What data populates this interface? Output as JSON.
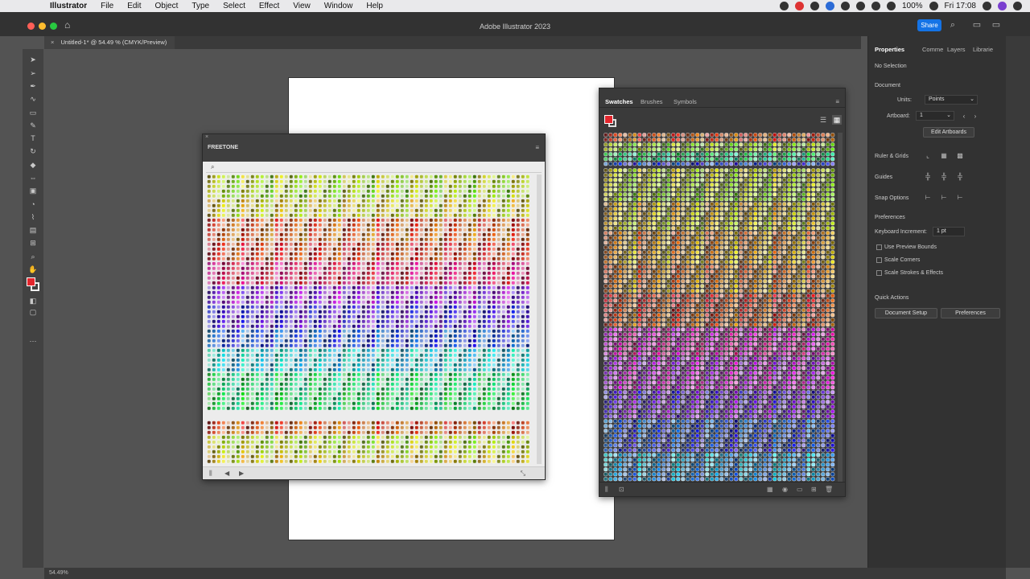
{
  "menubar": {
    "app": "Illustrator",
    "items": [
      "File",
      "Edit",
      "Object",
      "Type",
      "Select",
      "Effect",
      "View",
      "Window",
      "Help"
    ],
    "battery": "100%",
    "clock": "Fri 17:08"
  },
  "window": {
    "title": "Adobe Illustrator 2023",
    "share_label": "Share"
  },
  "document": {
    "tab_title": "Untitled-1* @ 54.49 % (CMYK/Preview)",
    "zoom": "54.49%"
  },
  "freetone_panel": {
    "title": "FREETONE"
  },
  "swatches_panel": {
    "tabs": [
      "Swatches",
      "Brushes",
      "Symbols"
    ],
    "active_tab": "Swatches"
  },
  "properties": {
    "tabs": [
      "Properties",
      "Comme",
      "Layers",
      "Librarie"
    ],
    "active_tab": "Properties",
    "selection": "No Selection",
    "document_heading": "Document",
    "units_label": "Units:",
    "units_value": "Points",
    "artboard_label": "Artboard:",
    "artboard_value": "1",
    "edit_artboards": "Edit Artboards",
    "ruler_grids": "Ruler & Grids",
    "guides": "Guides",
    "snap_options": "Snap Options",
    "preferences_heading": "Preferences",
    "keyboard_increment_label": "Keyboard Increment:",
    "keyboard_increment_value": "1 pt",
    "use_preview_bounds": "Use Preview Bounds",
    "scale_corners": "Scale Corners",
    "scale_strokes": "Scale Strokes & Effects",
    "quick_actions": "Quick Actions",
    "document_setup": "Document Setup",
    "preferences_button": "Preferences"
  },
  "colors": {
    "fill": "#e3262d",
    "accent": "#1473e6",
    "ui_dark": "#323232",
    "canvas": "#535353"
  }
}
